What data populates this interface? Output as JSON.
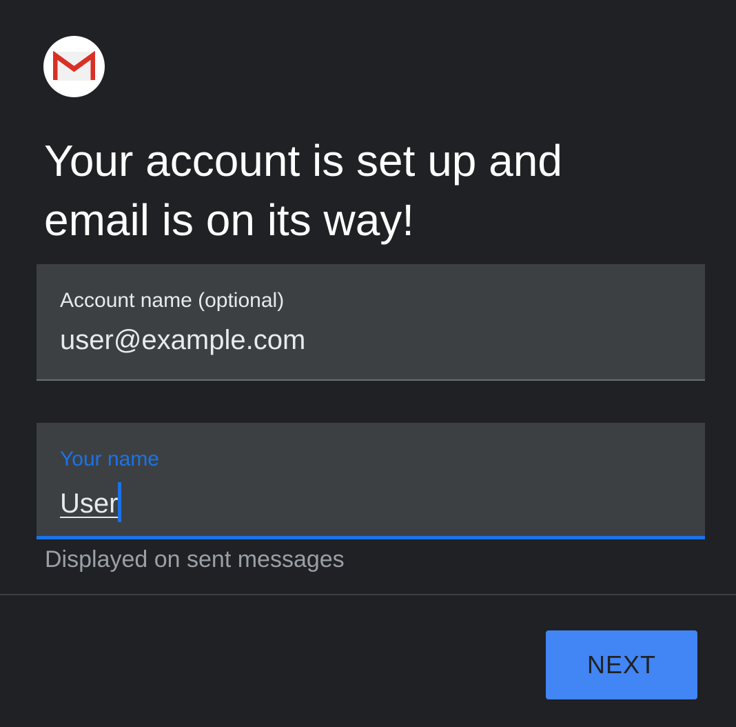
{
  "app": {
    "logo_icon": "gmail-icon",
    "brand_color_red": "#d93025"
  },
  "title": "Your account is set up and email is on its way!",
  "account_field": {
    "label": "Account name (optional)",
    "value": "user@example.com"
  },
  "name_field": {
    "label": "Your name",
    "value": "User",
    "helper": "Displayed on sent messages",
    "focus_color": "#1a73e8"
  },
  "actions": {
    "next_label": "NEXT",
    "next_color": "#4285f4"
  }
}
